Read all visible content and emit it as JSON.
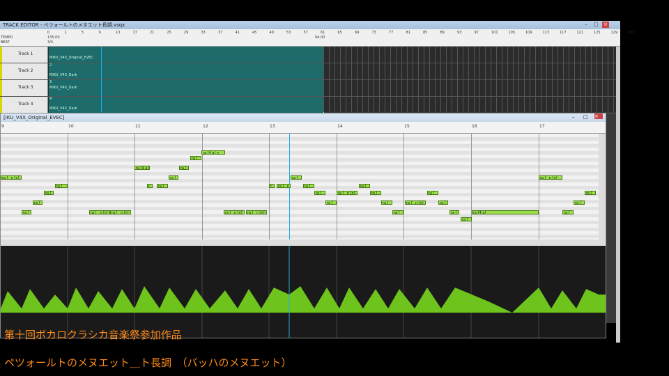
{
  "window": {
    "title": "TRACK EDITOR - ぺツォールトのメヌエット長調.vsqx"
  },
  "ruler": {
    "tempo_label": "TEMPO",
    "beat_label": "BEAT",
    "tempo_start": "135.00",
    "tempo_end": "94.00",
    "beat": "3/4",
    "measures": [
      "0",
      "1",
      "5",
      "9",
      "13",
      "17",
      "21",
      "25",
      "29",
      "33",
      "37",
      "41",
      "45",
      "49",
      "53",
      "57",
      "61",
      "65",
      "69",
      "73",
      "77",
      "81",
      "85",
      "89",
      "93",
      "97",
      "101",
      "105",
      "109",
      "113",
      "117",
      "121",
      "125",
      "129",
      "133"
    ]
  },
  "tracks": [
    {
      "name": "Track 1",
      "index": "1",
      "singer": "MIKU_V4X_Original_EVEC"
    },
    {
      "name": "Track 2",
      "index": "2",
      "singer": "MIKU_V4X_Dark"
    },
    {
      "name": "Track 3",
      "index": "3",
      "singer": "MIKU_V4X_Dark"
    },
    {
      "name": "Track 4",
      "index": "4",
      "singer": "MIKU_V4X_Dark"
    }
  ],
  "editor": {
    "title": "[IKU_V4X_Original_EVEC]",
    "measures": [
      "9",
      "10",
      "11",
      "12",
      "13",
      "14",
      "15",
      "16",
      "17"
    ]
  },
  "notes_text": {
    "n1": "ra [_ n [n]",
    "n2": "ra [",
    "n3": "ra [4 a]",
    "n4": "ra [_",
    "n5": "r",
    "n6": "ra [_ n [n]",
    "n7": "ra [4 a] n"
  },
  "captions": {
    "line1": "第十回ボカロクラシカ音楽祭参加作品",
    "line2": "ペツォールトのメヌエット＿ト長調　（バッハのメヌエット）"
  },
  "colors": {
    "accent": "#ff8a1a",
    "note": "#9be04a",
    "part": "#1d6b6b",
    "wave": "#6ec31c"
  }
}
